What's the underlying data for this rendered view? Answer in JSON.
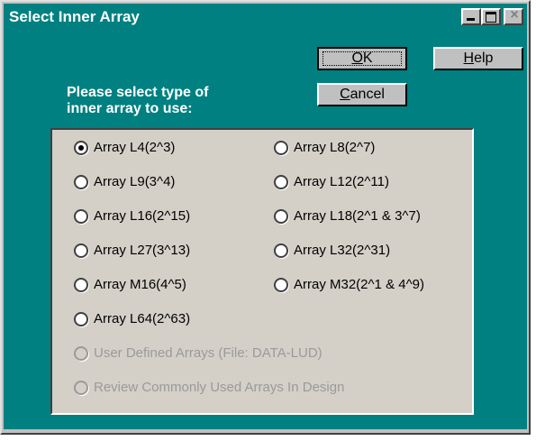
{
  "window": {
    "title": "Select Inner Array"
  },
  "buttons": {
    "ok": "OK",
    "help": "Help",
    "cancel": "Cancel"
  },
  "prompt": {
    "line1": "Please select type of",
    "line2": "inner array to use:"
  },
  "options": [
    {
      "label": "Array L4(2^3)",
      "checked": true,
      "enabled": true
    },
    {
      "label": "Array L8(2^7)",
      "checked": false,
      "enabled": true
    },
    {
      "label": "Array L9(3^4)",
      "checked": false,
      "enabled": true
    },
    {
      "label": "Array L12(2^11)",
      "checked": false,
      "enabled": true
    },
    {
      "label": "Array L16(2^15)",
      "checked": false,
      "enabled": true
    },
    {
      "label": "Array L18(2^1 & 3^7)",
      "checked": false,
      "enabled": true
    },
    {
      "label": "Array L27(3^13)",
      "checked": false,
      "enabled": true
    },
    {
      "label": "Array L32(2^31)",
      "checked": false,
      "enabled": true
    },
    {
      "label": "Array M16(4^5)",
      "checked": false,
      "enabled": true
    },
    {
      "label": "Array M32(2^1 & 4^9)",
      "checked": false,
      "enabled": true
    },
    {
      "label": "Array L64(2^63)",
      "checked": false,
      "enabled": true
    },
    {
      "label": "User Defined Arrays (File: DATA-LUD)",
      "checked": false,
      "enabled": false
    },
    {
      "label": "Review Commonly Used Arrays In Design",
      "checked": false,
      "enabled": false
    }
  ]
}
